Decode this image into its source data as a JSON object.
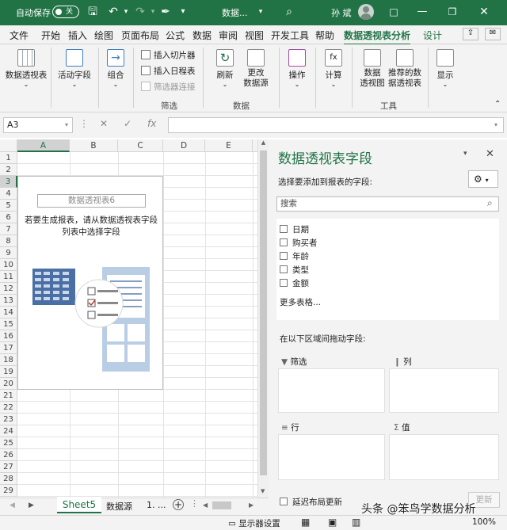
{
  "titlebar": {
    "autosave_label": "自动保存",
    "autosave_state": "关",
    "doc_title": "数据...",
    "user_name": "孙 斌"
  },
  "tabs": [
    "文件",
    "开始",
    "插入",
    "绘图",
    "页面布局",
    "公式",
    "数据",
    "审阅",
    "视图",
    "开发工具",
    "帮助",
    "数据透视表分析",
    "设计"
  ],
  "ribbon": {
    "pivot_table": "数据透视表",
    "active_field": "活动字段",
    "group": "组合",
    "insert_slicer": "插入切片器",
    "insert_timeline": "插入日程表",
    "filter_connections": "筛选器连接",
    "filter_group": "筛选",
    "refresh": "刷新",
    "change_source_1": "更改",
    "change_source_2": "数据源",
    "data_group": "数据",
    "actions": "操作",
    "calculations": "计算",
    "pivot_chart_1": "数据",
    "pivot_chart_2": "透视图",
    "recommended_1": "推荐的数",
    "recommended_2": "据透视表",
    "tools_group": "工具",
    "show": "显示"
  },
  "formula_bar": {
    "name_box": "A3",
    "fx": "fx",
    "value": ""
  },
  "grid": {
    "columns": [
      "A",
      "B",
      "C",
      "D",
      "E"
    ],
    "rows": [
      "1",
      "2",
      "3",
      "4",
      "5",
      "6",
      "7",
      "8",
      "9",
      "10",
      "11",
      "12",
      "13",
      "14",
      "15",
      "16",
      "17",
      "18",
      "19",
      "20",
      "21",
      "22",
      "23",
      "24",
      "25",
      "26",
      "27",
      "28",
      "29"
    ],
    "selected_cell": "A3"
  },
  "pivot_placeholder": {
    "name": "数据透视表6",
    "instruction": "若要生成报表，请从数据透视表字段列表中选择字段"
  },
  "sheets": {
    "tabs": [
      "Sheet5",
      "数据源",
      "1. ..."
    ],
    "active": "Sheet5"
  },
  "status": {
    "display_settings": "显示器设置",
    "zoom": "100%"
  },
  "pane": {
    "title": "数据透视表字段",
    "subtitle": "选择要添加到报表的字段:",
    "search_placeholder": "搜索",
    "fields": [
      "日期",
      "购买者",
      "年龄",
      "类型",
      "金额"
    ],
    "more_tables": "更多表格...",
    "drag_hint": "在以下区域间拖动字段:",
    "areas": {
      "filter": "筛选",
      "columns": "列",
      "rows": "行",
      "values": "值"
    },
    "defer_update": "延迟布局更新",
    "update_button": "更新"
  },
  "watermark": "头条 @笨鸟学数据分析",
  "colors": {
    "brand": "#217346",
    "selection": "#217346"
  }
}
